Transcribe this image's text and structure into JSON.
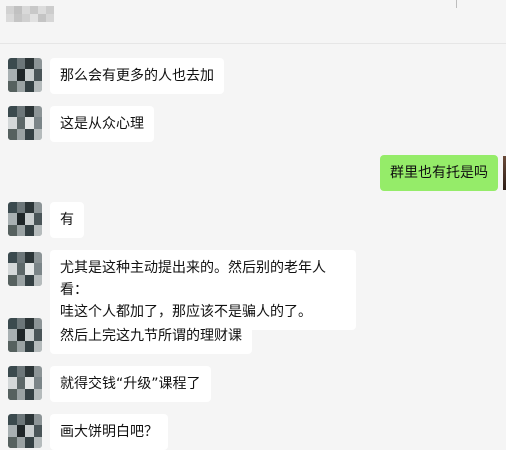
{
  "header": {
    "title": ""
  },
  "messages": [
    {
      "side": "left",
      "text": "那么会有更多的人也去加"
    },
    {
      "side": "left",
      "text": "这是从众心理"
    },
    {
      "side": "right",
      "text": "群里也有托是吗"
    },
    {
      "side": "left",
      "text": "有"
    },
    {
      "side": "left",
      "line1": "尤其是这种主动提出来的。然后别的老年人看：",
      "line2": "哇这个人都加了，那应该不是骗人的了。"
    },
    {
      "side": "left",
      "text": "然后上完这九节所谓的理财课"
    },
    {
      "side": "left",
      "text": "就得交钱“升级”课程了"
    },
    {
      "side": "left",
      "text": "画大饼明白吧？"
    }
  ],
  "colors": {
    "background": "#f5f5f5",
    "incoming_bubble": "#ffffff",
    "outgoing_bubble": "#95ec69"
  }
}
